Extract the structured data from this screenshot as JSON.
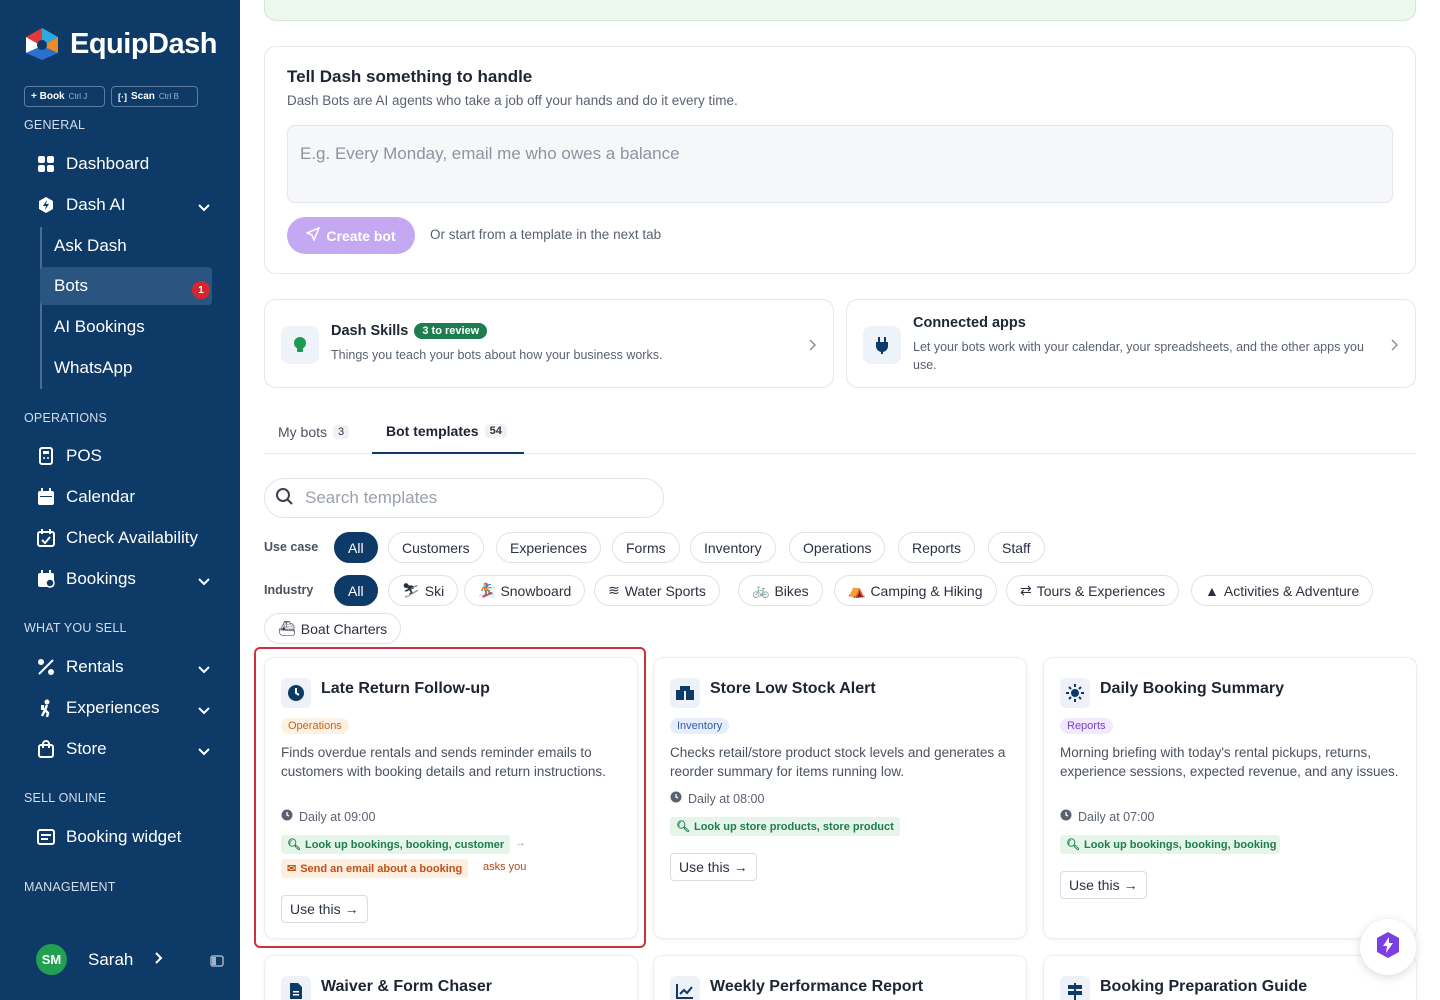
{
  "brand": {
    "name": "EquipDash"
  },
  "quick_actions": [
    {
      "label": "+ Book",
      "shortcut": "Ctrl J"
    },
    {
      "label": "Scan",
      "shortcut": "Ctrl B"
    }
  ],
  "sidebar": {
    "general": "GENERAL",
    "dashboard": "Dashboard",
    "dash_ai": "Dash AI",
    "ask_dash": "Ask Dash",
    "bots": "Bots",
    "bots_badge": "1",
    "ai_bookings": "AI Bookings",
    "whatsapp": "WhatsApp",
    "operations": "OPERATIONS",
    "pos": "POS",
    "calendar": "Calendar",
    "check_availability": "Check Availability",
    "bookings": "Bookings",
    "what_you_sell": "WHAT YOU SELL",
    "rentals": "Rentals",
    "experiences": "Experiences",
    "store": "Store",
    "sell_online": "SELL ONLINE",
    "booking_widget": "Booking widget",
    "management": "MANAGEMENT",
    "user_initials": "SM",
    "user_name": "Sarah"
  },
  "create": {
    "title": "Tell Dash something to handle",
    "subtitle": "Dash Bots are AI agents who take a job off your hands and do it every time.",
    "placeholder": "E.g. Every Monday, email me who owes a balance",
    "button": "Create bot",
    "hint": "Or start from a template in the next tab"
  },
  "skills": {
    "title": "Dash Skills",
    "badge": "3 to review",
    "desc": "Things you teach your bots about how your business works."
  },
  "apps": {
    "title": "Connected apps",
    "desc": "Let your bots work with your calendar, your spreadsheets, and the other apps you use."
  },
  "tabs": [
    {
      "label": "My bots",
      "count": "3"
    },
    {
      "label": "Bot templates",
      "count": "54"
    }
  ],
  "search": {
    "placeholder": "Search templates"
  },
  "filters": {
    "use_case_label": "Use case",
    "use_case": [
      "All",
      "Customers",
      "Experiences",
      "Forms",
      "Inventory",
      "Operations",
      "Reports",
      "Staff"
    ],
    "industry_label": "Industry",
    "industry": [
      "All",
      "Ski",
      "Snowboard",
      "Water Sports",
      "Bikes",
      "Camping & Hiking",
      "Tours & Experiences",
      "Activities & Adventure",
      "Boat Charters"
    ]
  },
  "templates": [
    {
      "title": "Late Return Follow-up",
      "tag": "Operations",
      "desc": "Finds overdue rentals and sends reminder emails to customers with booking details and return instructions.",
      "schedule": "Daily at 09:00",
      "tool1": "Look up bookings, booking, customer",
      "tool2": "Send an email about a booking",
      "tool2_note": "asks you",
      "use": "Use this"
    },
    {
      "title": "Store Low Stock Alert",
      "tag": "Inventory",
      "desc": "Checks retail/store product stock levels and generates a reorder summary for items running low.",
      "schedule": "Daily at 08:00",
      "tool1": "Look up store products, store product",
      "use": "Use this"
    },
    {
      "title": "Daily Booking Summary",
      "tag": "Reports",
      "desc": "Morning briefing with today's rental pickups, returns, experience sessions, expected revenue, and any issues.",
      "schedule": "Daily at 07:00",
      "tool1": "Look up bookings, booking, booking st",
      "use": "Use this"
    },
    {
      "title": "Waiver & Form Chaser"
    },
    {
      "title": "Weekly Performance Report"
    },
    {
      "title": "Booking Preparation Guide"
    }
  ],
  "colors": {
    "sidebar": "#0d3a66",
    "accent": "#0d3a66",
    "create_button": "#c5a8f2",
    "badge_red": "#d7252e",
    "selected_outline": "#d0303e"
  }
}
